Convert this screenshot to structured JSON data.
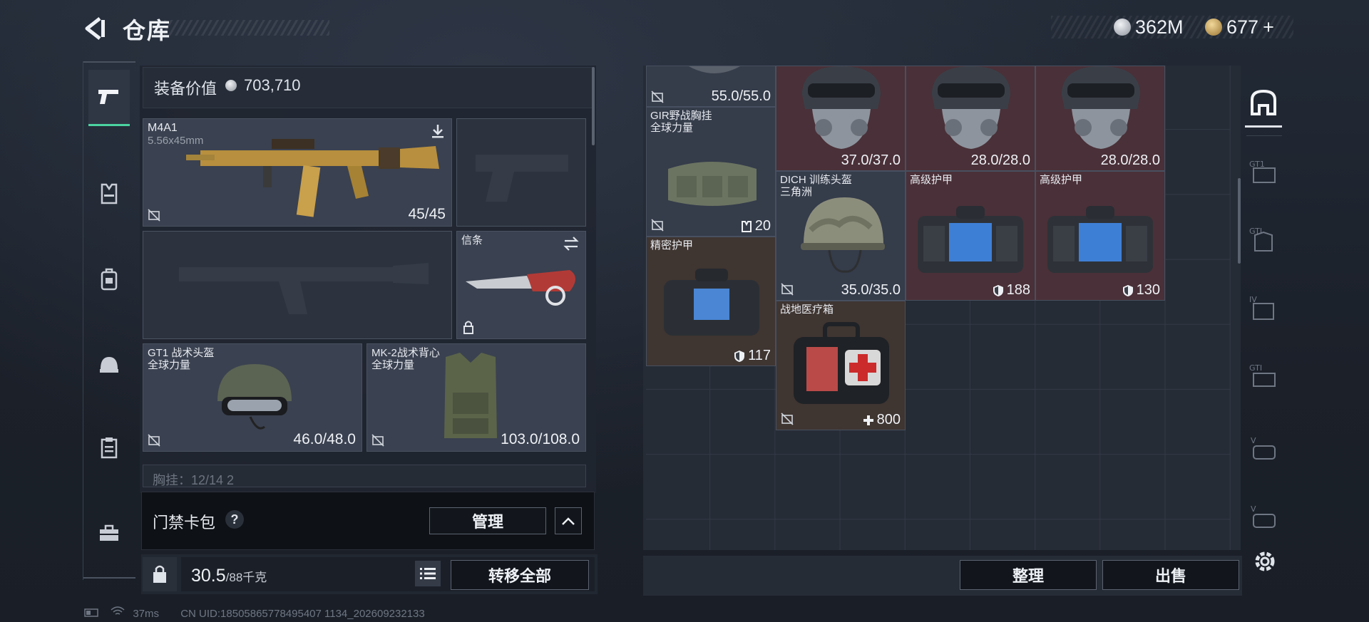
{
  "header": {
    "title": "仓库"
  },
  "currency": [
    {
      "amount": "362M",
      "icon": "silver-coin-icon",
      "color": "#c8cdd5"
    },
    {
      "amount": "677",
      "icon": "gold-coin-icon",
      "color": "#c9a45a",
      "suffix": "+"
    }
  ],
  "loadout": {
    "value_label": "装备价值",
    "value": "703,710",
    "slots": {
      "primary": {
        "name": "M4A1",
        "sub": "5.56x45mm",
        "count": "45/45"
      },
      "knife": {
        "name": "信条"
      },
      "helmet": {
        "name": "GT1 战术头盔\n全球力量",
        "count": "46.0/48.0"
      },
      "armor": {
        "name": "MK-2战术背心\n全球力量",
        "count": "103.0/108.0"
      }
    },
    "chest_rig_row": "胸挂：12/14  2"
  },
  "keybag": {
    "label": "门禁卡包",
    "help": "?",
    "manage_label": "管理"
  },
  "weight": {
    "value": "30.5",
    "max": "/88千克"
  },
  "transfer_all_label": "转移全部",
  "status": {
    "ping": "37ms",
    "uid": "CN UID:18505865778495407 1134_202609232133"
  },
  "storage": {
    "items": [
      {
        "id": "top-helmet",
        "name": "",
        "count": "55.0/55.0"
      },
      {
        "id": "gas-helmet-1",
        "name": "",
        "count": "37.0/37.0"
      },
      {
        "id": "gas-helmet-2",
        "name": "",
        "count": "28.0/28.0"
      },
      {
        "id": "gas-helmet-3",
        "name": "",
        "count": "28.0/28.0"
      },
      {
        "id": "gir-rig",
        "name": "GIR野战胸挂\n全球力量",
        "count": "20"
      },
      {
        "id": "dich-helmet",
        "name": "DICH 训练头盔\n三角洲",
        "count": "35.0/35.0"
      },
      {
        "id": "adv-armor-1",
        "name": "高级护甲",
        "count": "188"
      },
      {
        "id": "adv-armor-2",
        "name": "高级护甲",
        "count": "130"
      },
      {
        "id": "precise-armor",
        "name": "精密护甲",
        "count": "117"
      },
      {
        "id": "medkit",
        "name": "战地医疗箱",
        "count": "800"
      }
    ]
  },
  "actions": {
    "sort_label": "整理",
    "sell_label": "出售"
  },
  "filters": [
    "GT1",
    "GTI",
    "IV",
    "GTI",
    "V",
    "V"
  ]
}
